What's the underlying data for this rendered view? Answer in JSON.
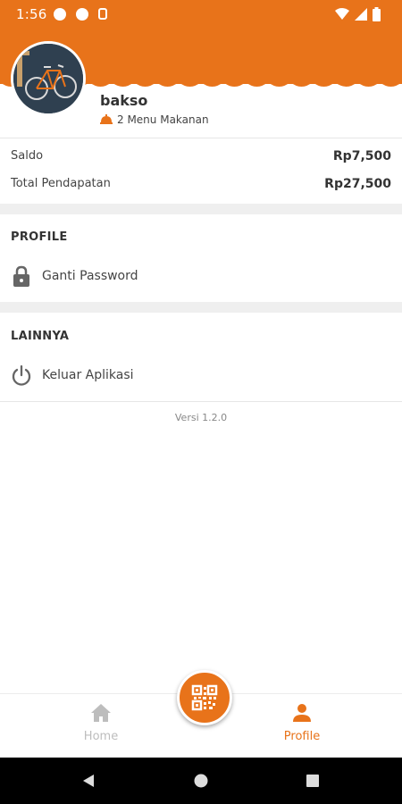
{
  "status_bar": {
    "time": "1:56"
  },
  "profile": {
    "name": "bakso",
    "menu_count": "2 Menu Makanan"
  },
  "balance": {
    "saldo_label": "Saldo",
    "saldo_value": "Rp7,500",
    "income_label": "Total Pendapatan",
    "income_value": "Rp27,500"
  },
  "sections": {
    "profile_title": "PROFILE",
    "change_password": "Ganti Password",
    "other_title": "LAINNYA",
    "logout": "Keluar Aplikasi"
  },
  "version": "Versi 1.2.0",
  "bottom_nav": {
    "home": "Home",
    "profile": "Profile"
  },
  "colors": {
    "accent": "#e8731a",
    "inactive": "#bdbdbd"
  }
}
